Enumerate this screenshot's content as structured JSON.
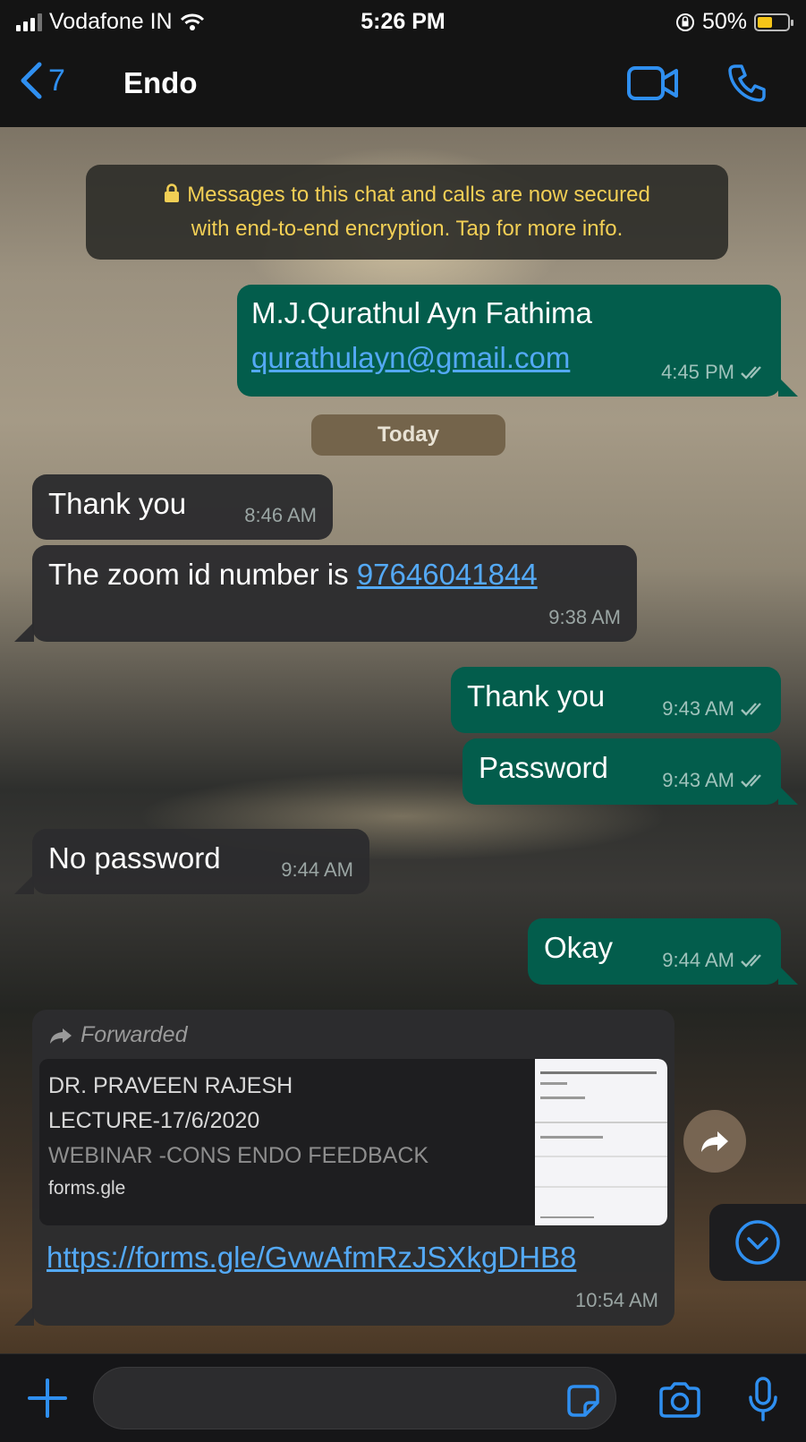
{
  "status_bar": {
    "carrier": "Vodafone IN",
    "time": "5:26 PM",
    "battery": "50%",
    "battery_level": 0.5
  },
  "header": {
    "back_count": "7",
    "title": "Endo"
  },
  "system_notice": {
    "line1": "Messages to this chat and calls are now secured",
    "line2": "with end-to-end encryption. Tap for more info."
  },
  "messages": [
    {
      "line1": "M.J.Qurathul Ayn Fathima",
      "link": "qurathulayn@gmail.com",
      "time": "4:45 PM"
    },
    {
      "date": "Today"
    },
    {
      "text": "Thank you",
      "time": "8:46 AM"
    },
    {
      "text": "The zoom id number is ",
      "link": "97646041844",
      "time": "9:38 AM"
    },
    {
      "text": "Thank you",
      "time": "9:43 AM"
    },
    {
      "text": "Password",
      "time": "9:43 AM"
    },
    {
      "text": "No password",
      "time": "9:44 AM"
    },
    {
      "text": "Okay",
      "time": "9:44 AM"
    }
  ],
  "forwarded": {
    "label": "Forwarded",
    "preview_line1": "DR. PRAVEEN RAJESH",
    "preview_line2": "LECTURE-17/6/2020",
    "preview_line3": "WEBINAR -CONS ENDO FEEDBACK",
    "preview_domain": "forms.gle",
    "url": "https://forms.gle/GvwAfmRzJSXkgDHB8",
    "time": "10:54 AM"
  },
  "input": {
    "placeholder": ""
  },
  "colors": {
    "accent": "#2f8ff0",
    "outgoing": "#035d4c",
    "incoming": "#2c2c2e",
    "notice": "#f2cf55",
    "link": "#54a9f5"
  }
}
